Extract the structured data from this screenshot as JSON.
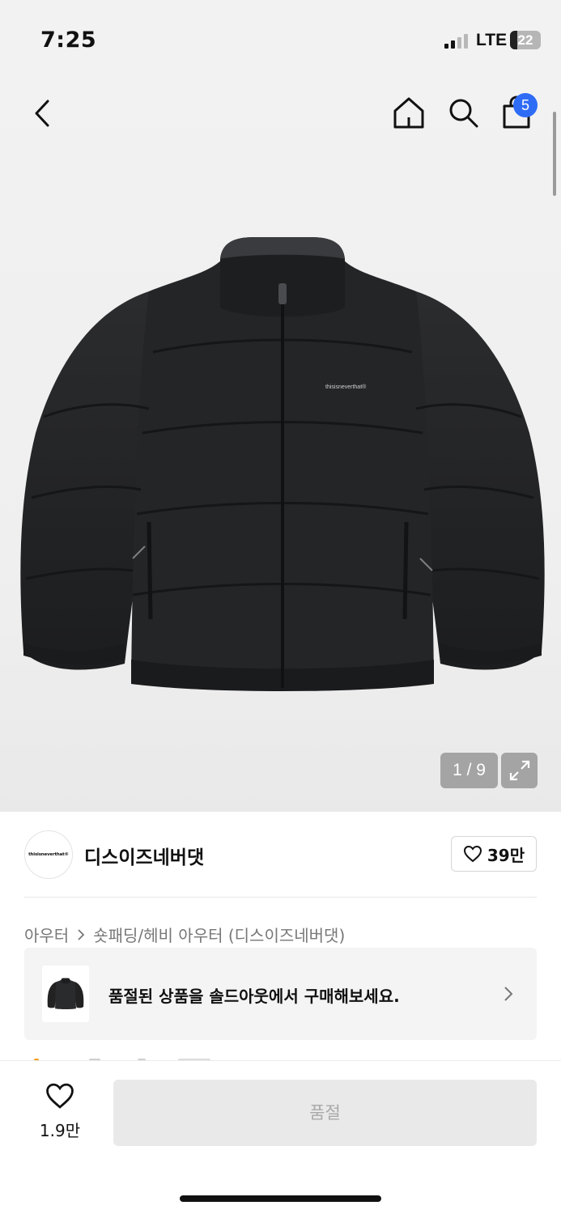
{
  "status_bar": {
    "time": "7:25",
    "network": "LTE",
    "battery": "22"
  },
  "nav": {
    "cart_count": "5"
  },
  "gallery": {
    "page_counter": "1 / 9",
    "jacket_print": "thisisneverthat®"
  },
  "brand": {
    "logo_text": "thisisneverthat®",
    "name": "디스이즈네버댓",
    "likes": "39만"
  },
  "breadcrumb": {
    "level1": "아우터",
    "level2": "숏패딩/헤비 아우터 (디스이즈네버댓)"
  },
  "soldout_banner": {
    "text": "품절된 상품을 솔드아웃에서 구매해보세요."
  },
  "bottom_bar": {
    "wish_count": "1.9만",
    "buy_label": "품절"
  },
  "colors": {
    "badge": "#2f6cf6",
    "disabled_button": "#e9e9e9",
    "disabled_text": "#a9a9a9"
  },
  "icons": [
    "back-icon",
    "home-icon",
    "search-icon",
    "cart-icon",
    "expand-icon",
    "heart-icon",
    "chevron-right-icon"
  ]
}
